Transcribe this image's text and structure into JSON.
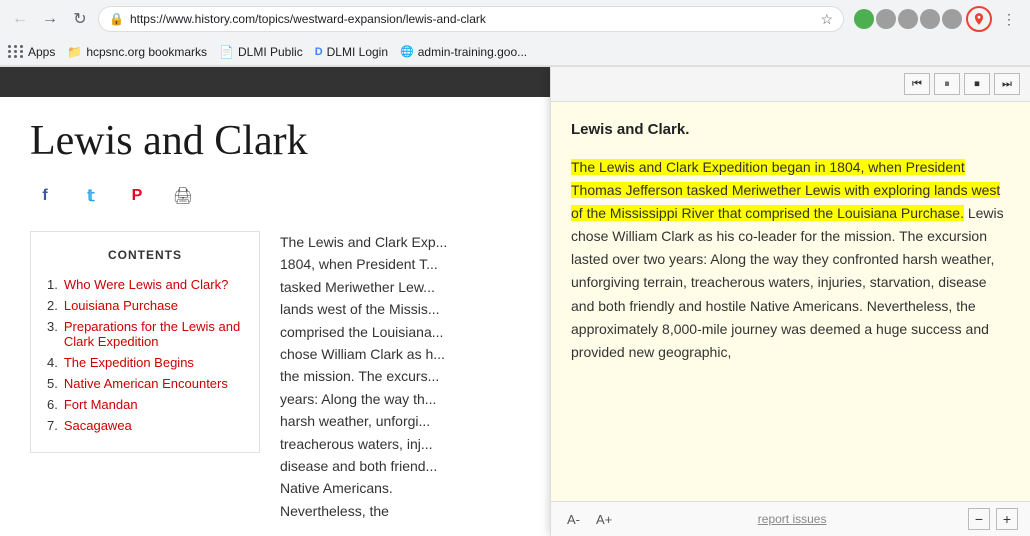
{
  "browser": {
    "url": "https://www.history.com/topics/westward-expansion/lewis-and-clark",
    "back_disabled": false,
    "forward_disabled": false
  },
  "bookmarks": [
    {
      "id": "apps",
      "label": "Apps",
      "icon": "grid"
    },
    {
      "id": "hcpsnc",
      "label": "hcpsnc.org bookmarks",
      "icon": "folder"
    },
    {
      "id": "dlmi-public",
      "label": "DLMI Public",
      "icon": "page"
    },
    {
      "id": "dlmi-login",
      "label": "DLMI Login",
      "icon": "dlmi"
    },
    {
      "id": "admin-training",
      "label": "admin-training.goo...",
      "icon": "google"
    }
  ],
  "page": {
    "title": "Lewis and Clark",
    "header_strip": true
  },
  "social": {
    "facebook": "f",
    "twitter": "t",
    "pinterest": "p",
    "print": "🖨"
  },
  "contents": {
    "title": "CONTENTS",
    "items": [
      {
        "num": "1.",
        "label": "Who Were Lewis and Clark?"
      },
      {
        "num": "2.",
        "label": "Louisiana Purchase"
      },
      {
        "num": "3.",
        "label": "Preparations for the Lewis and Clark Expedition"
      },
      {
        "num": "4.",
        "label": "The Expedition Begins"
      },
      {
        "num": "5.",
        "label": "Native American Encounters"
      },
      {
        "num": "6.",
        "label": "Fort Mandan"
      },
      {
        "num": "7.",
        "label": "Sacagawea"
      }
    ]
  },
  "article": {
    "text": "The Lewis and Clark Exp... 1804, when President T... tasked Meriwether Lew... lands west of the Missis... comprised the Louisiana... chose William Clark as h... the mission. The excurs... years: Along the way th... harsh weather, unforgi... treacherous waters, inj... disease and both friend... Native Americans. Nevertheless, the"
  },
  "reader": {
    "title": "Lewis and Clark.",
    "highlighted_text": "The Lewis and Clark Expedition began in 1804, when President Thomas Jefferson tasked Meriwether Lewis with exploring lands west of the Mississippi River that comprised the Louisiana Purchase.",
    "normal_text": " Lewis chose William Clark as his co-leader for the mission. The excursion lasted over two years: Along the way they confronted harsh weather, unforgiving terrain, treacherous waters, injuries, starvation, disease and both friendly and hostile Native Americans. Nevertheless, the approximately 8,000-mile journey was deemed a huge success and provided new geographic,",
    "font_minus": "A-",
    "font_plus": "A+",
    "report_label": "report issues",
    "zoom_minus": "−",
    "zoom_plus": "+",
    "controls": {
      "skip_back": "⏮",
      "pause": "⏸",
      "stop": "⏹",
      "skip_forward": "⏭"
    }
  }
}
